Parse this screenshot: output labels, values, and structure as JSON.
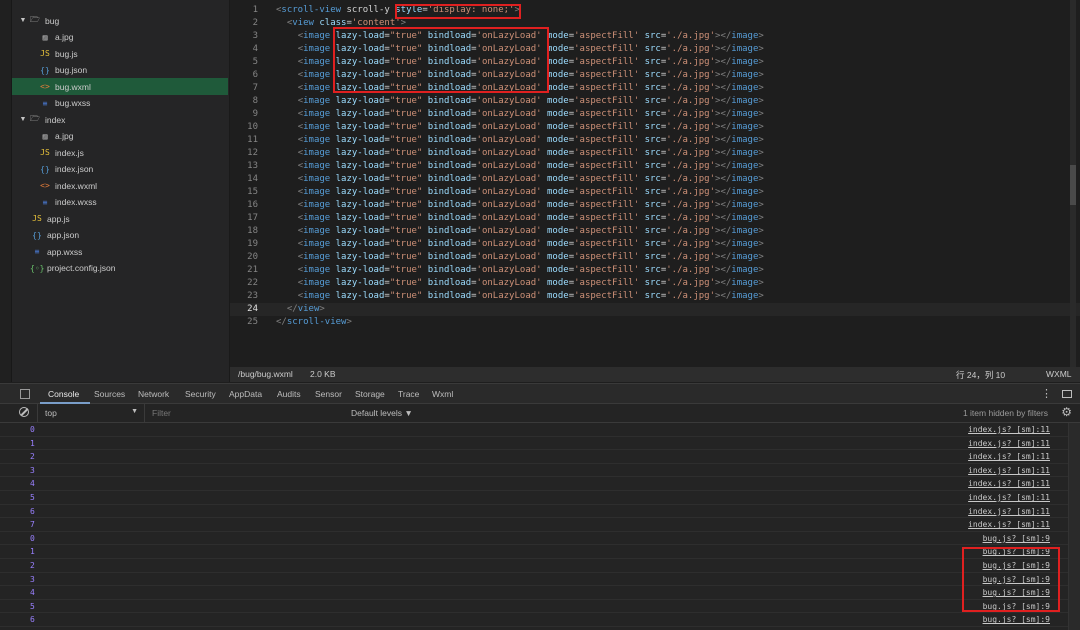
{
  "file_tree": {
    "items": [
      {
        "label": "bug",
        "icon": "folder-icon",
        "type": "folder",
        "expanded": true
      },
      {
        "label": "a.jpg",
        "icon": "image-file-icon",
        "type": "file"
      },
      {
        "label": "bug.js",
        "icon": "js-file-icon",
        "type": "file"
      },
      {
        "label": "bug.json",
        "icon": "json-file-icon",
        "type": "file"
      },
      {
        "label": "bug.wxml",
        "icon": "wxml-file-icon",
        "type": "file",
        "selected": true
      },
      {
        "label": "bug.wxss",
        "icon": "wxss-file-icon",
        "type": "file"
      },
      {
        "label": "index",
        "icon": "folder-icon",
        "type": "folder",
        "expanded": true
      },
      {
        "label": "a.jpg",
        "icon": "image-file-icon",
        "type": "file"
      },
      {
        "label": "index.js",
        "icon": "js-file-icon",
        "type": "file"
      },
      {
        "label": "index.json",
        "icon": "json-file-icon",
        "type": "file"
      },
      {
        "label": "index.wxml",
        "icon": "wxml-file-icon",
        "type": "file"
      },
      {
        "label": "index.wxss",
        "icon": "wxss-file-icon",
        "type": "file"
      },
      {
        "label": "app.js",
        "icon": "js-file-icon",
        "type": "file"
      },
      {
        "label": "app.json",
        "icon": "json-file-icon",
        "type": "file"
      },
      {
        "label": "app.wxss",
        "icon": "wxss-file-icon",
        "type": "file"
      },
      {
        "label": "project.config.json",
        "icon": "config-file-icon",
        "type": "file"
      }
    ]
  },
  "editor": {
    "current_line": 24,
    "lines": [
      {
        "n": "1",
        "text": "<scroll-view scroll-y style='display: none;'>"
      },
      {
        "n": "2",
        "text": "  <view class='content'>"
      },
      {
        "n": "3",
        "text": "    <image lazy-load=\"true\" bindload='onLazyLoad' mode='aspectFill' src='./a.jpg'></image>"
      },
      {
        "n": "4",
        "text": "    <image lazy-load=\"true\" bindload='onLazyLoad' mode='aspectFill' src='./a.jpg'></image>"
      },
      {
        "n": "5",
        "text": "    <image lazy-load=\"true\" bindload='onLazyLoad' mode='aspectFill' src='./a.jpg'></image>"
      },
      {
        "n": "6",
        "text": "    <image lazy-load=\"true\" bindload='onLazyLoad' mode='aspectFill' src='./a.jpg'></image>"
      },
      {
        "n": "7",
        "text": "    <image lazy-load=\"true\" bindload='onLazyLoad' mode='aspectFill' src='./a.jpg'></image>"
      },
      {
        "n": "8",
        "text": "    <image lazy-load=\"true\" bindload='onLazyLoad' mode='aspectFill' src='./a.jpg'></image>"
      },
      {
        "n": "9",
        "text": "    <image lazy-load=\"true\" bindload='onLazyLoad' mode='aspectFill' src='./a.jpg'></image>"
      },
      {
        "n": "10",
        "text": "    <image lazy-load=\"true\" bindload='onLazyLoad' mode='aspectFill' src='./a.jpg'></image>"
      },
      {
        "n": "11",
        "text": "    <image lazy-load=\"true\" bindload='onLazyLoad' mode='aspectFill' src='./a.jpg'></image>"
      },
      {
        "n": "12",
        "text": "    <image lazy-load=\"true\" bindload='onLazyLoad' mode='aspectFill' src='./a.jpg'></image>"
      },
      {
        "n": "13",
        "text": "    <image lazy-load=\"true\" bindload='onLazyLoad' mode='aspectFill' src='./a.jpg'></image>"
      },
      {
        "n": "14",
        "text": "    <image lazy-load=\"true\" bindload='onLazyLoad' mode='aspectFill' src='./a.jpg'></image>"
      },
      {
        "n": "15",
        "text": "    <image lazy-load=\"true\" bindload='onLazyLoad' mode='aspectFill' src='./a.jpg'></image>"
      },
      {
        "n": "16",
        "text": "    <image lazy-load=\"true\" bindload='onLazyLoad' mode='aspectFill' src='./a.jpg'></image>"
      },
      {
        "n": "17",
        "text": "    <image lazy-load=\"true\" bindload='onLazyLoad' mode='aspectFill' src='./a.jpg'></image>"
      },
      {
        "n": "18",
        "text": "    <image lazy-load=\"true\" bindload='onLazyLoad' mode='aspectFill' src='./a.jpg'></image>"
      },
      {
        "n": "19",
        "text": "    <image lazy-load=\"true\" bindload='onLazyLoad' mode='aspectFill' src='./a.jpg'></image>"
      },
      {
        "n": "20",
        "text": "    <image lazy-load=\"true\" bindload='onLazyLoad' mode='aspectFill' src='./a.jpg'></image>"
      },
      {
        "n": "21",
        "text": "    <image lazy-load=\"true\" bindload='onLazyLoad' mode='aspectFill' src='./a.jpg'></image>"
      },
      {
        "n": "22",
        "text": "    <image lazy-load=\"true\" bindload='onLazyLoad' mode='aspectFill' src='./a.jpg'></image>"
      },
      {
        "n": "23",
        "text": "    <image lazy-load=\"true\" bindload='onLazyLoad' mode='aspectFill' src='./a.jpg'></image>"
      },
      {
        "n": "24",
        "text": "  </view>"
      },
      {
        "n": "25",
        "text": "</scroll-view>"
      }
    ]
  },
  "status_bar": {
    "file_path": "/bug/bug.wxml",
    "file_size": "2.0 KB",
    "cursor": "行 24，列 10",
    "language": "WXML"
  },
  "devtools": {
    "tabs": [
      "Console",
      "Sources",
      "Network",
      "Security",
      "AppData",
      "Audits",
      "Sensor",
      "Storage",
      "Trace",
      "Wxml"
    ],
    "active_tab": "Console",
    "context": "top",
    "filter_placeholder": "Filter",
    "levels": "Default levels ▼",
    "hidden_info": "1 item hidden by filters"
  },
  "console": {
    "rows": [
      {
        "value": "0",
        "source": "index.js? [sm]:11"
      },
      {
        "value": "1",
        "source": "index.js? [sm]:11"
      },
      {
        "value": "2",
        "source": "index.js? [sm]:11"
      },
      {
        "value": "3",
        "source": "index.js? [sm]:11"
      },
      {
        "value": "4",
        "source": "index.js? [sm]:11"
      },
      {
        "value": "5",
        "source": "index.js? [sm]:11"
      },
      {
        "value": "6",
        "source": "index.js? [sm]:11"
      },
      {
        "value": "7",
        "source": "index.js? [sm]:11"
      },
      {
        "value": "0",
        "source": "bug.js? [sm]:9"
      },
      {
        "value": "1",
        "source": "bug.js? [sm]:9"
      },
      {
        "value": "2",
        "source": "bug.js? [sm]:9"
      },
      {
        "value": "3",
        "source": "bug.js? [sm]:9"
      },
      {
        "value": "4",
        "source": "bug.js? [sm]:9"
      },
      {
        "value": "5",
        "source": "bug.js? [sm]:9"
      },
      {
        "value": "6",
        "source": "bug.js? [sm]:9"
      }
    ]
  },
  "colors": {
    "highlight_box": "#e02020",
    "selected_file": "#1f5a3a",
    "console_number": "#9980ff"
  }
}
